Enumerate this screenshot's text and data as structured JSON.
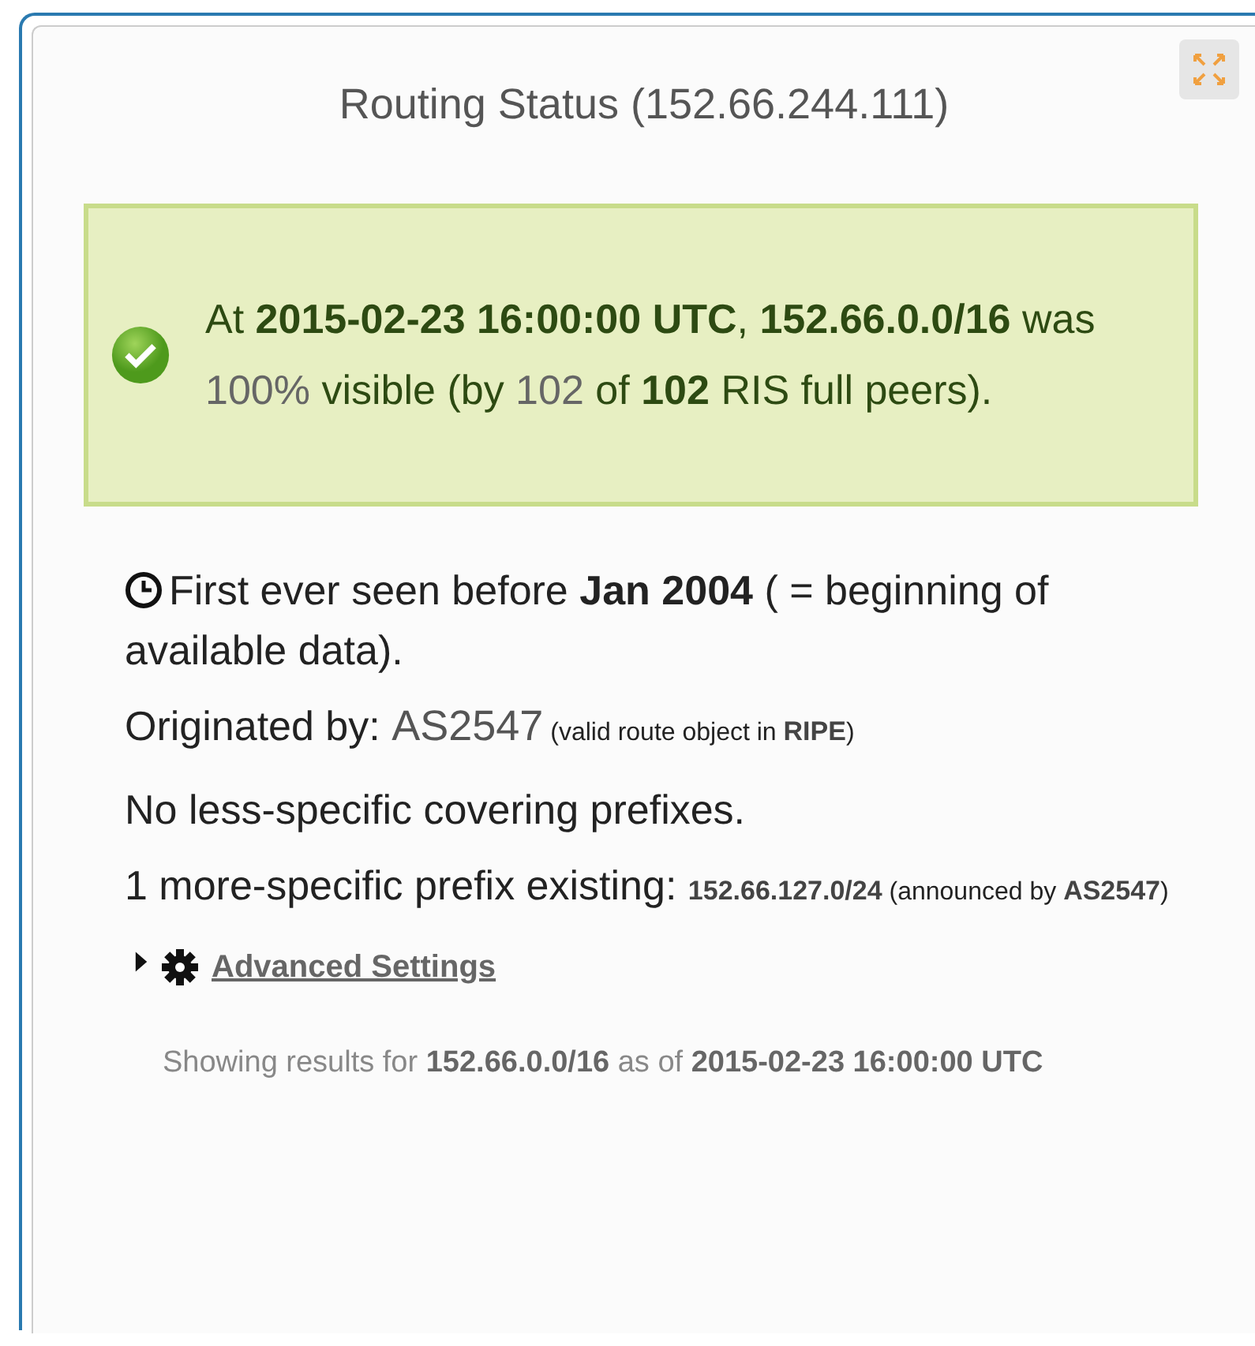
{
  "widget": {
    "title": "Routing Status (152.66.244.111)"
  },
  "status": {
    "ok": true,
    "parts": [
      {
        "kind": "plain",
        "text": "At "
      },
      {
        "kind": "bold",
        "text": "2015-02-23 16:00:00 UTC"
      },
      {
        "kind": "plain",
        "text": ", "
      },
      {
        "kind": "bold",
        "text": "152.66.0.0/16"
      },
      {
        "kind": "plain",
        "text": " was "
      },
      {
        "kind": "muted",
        "text": "100%"
      },
      {
        "kind": "plain",
        "text": " visible (by "
      },
      {
        "kind": "muted",
        "text": "102"
      },
      {
        "kind": "plain",
        "text": " of "
      },
      {
        "kind": "bold",
        "text": "102"
      },
      {
        "kind": "plain",
        "text": " RIS full peers)."
      }
    ]
  },
  "facts": [
    {
      "kind": "dated",
      "parts": [
        {
          "kind": "plain",
          "text": "First ever seen before "
        },
        {
          "kind": "bold",
          "text": "Jan 2004"
        },
        {
          "kind": "plain",
          "text": " ( = beginning of available data)."
        }
      ]
    },
    {
      "parts": [
        {
          "kind": "plain",
          "text": "Originated by: "
        },
        {
          "kind": "muted",
          "text": "AS2547"
        },
        {
          "kind": "small",
          "text": " (valid route object in "
        },
        {
          "kind": "smallbold",
          "text": "RIPE"
        },
        {
          "kind": "small",
          "text": ")"
        }
      ]
    },
    {
      "parts": [
        {
          "kind": "plain",
          "text": "No less-specific covering prefixes."
        }
      ]
    },
    {
      "parts": [
        {
          "kind": "plain",
          "text": "1 more-specific prefix existing: "
        },
        {
          "kind": "smallbold",
          "text": "152.66.127.0/24"
        },
        {
          "kind": "small",
          "text": " (announced by "
        },
        {
          "kind": "smallbold",
          "text": "AS2547"
        },
        {
          "kind": "small",
          "text": ")"
        }
      ]
    }
  ],
  "advanced": {
    "label": "Advanced Settings",
    "expanded": false
  },
  "footer": {
    "parts": [
      {
        "kind": "plain",
        "text": "Showing results for "
      },
      {
        "kind": "bold",
        "text": "152.66.0.0/16"
      },
      {
        "kind": "plain",
        "text": " as of "
      },
      {
        "kind": "bold",
        "text": "2015-02-23 16:00:00 UTC"
      }
    ]
  }
}
